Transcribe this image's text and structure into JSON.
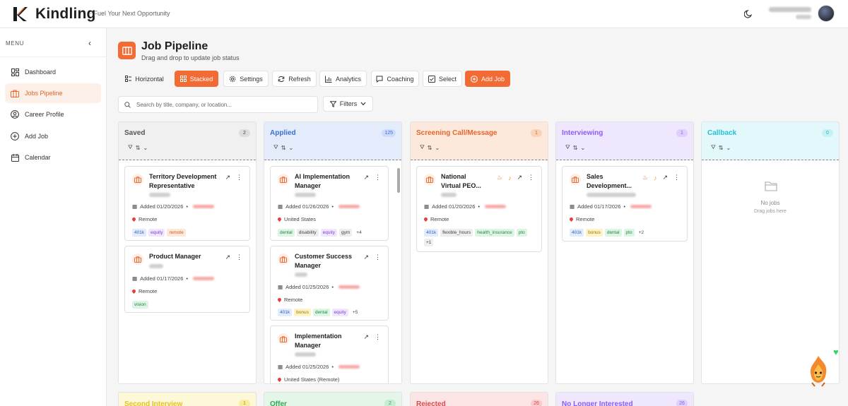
{
  "app": {
    "name": "Kindling",
    "tagline": "Fuel Your Next Opportunity"
  },
  "sidebar": {
    "menu_label": "MENU",
    "items": [
      {
        "label": "Dashboard"
      },
      {
        "label": "Jobs Pipeline"
      },
      {
        "label": "Career Profile"
      },
      {
        "label": "Add Job"
      },
      {
        "label": "Calendar"
      }
    ]
  },
  "page": {
    "title": "Job Pipeline",
    "subtitle": "Drag and drop to update job status"
  },
  "toolbar": {
    "horizontal": "Horizontal",
    "stacked": "Stacked",
    "settings": "Settings",
    "refresh": "Refresh",
    "analytics": "Analytics",
    "coaching": "Coaching",
    "select": "Select",
    "add_job": "Add Job"
  },
  "search": {
    "placeholder": "Search by title, company, or location..."
  },
  "filters_label": "Filters",
  "columns": [
    {
      "title": "Saved",
      "count": "2",
      "color": "#555555",
      "cards": [
        {
          "title": "Territory Development Representative",
          "added": "Added 01/20/2026",
          "location": "Remote",
          "tags": [
            "401k",
            "equity",
            "remote"
          ]
        },
        {
          "title": "Product Manager",
          "added": "Added 01/17/2026",
          "location": "Remote",
          "tags": [
            "vision"
          ]
        }
      ]
    },
    {
      "title": "Applied",
      "count": "125",
      "color": "#3b6fd1",
      "cards": [
        {
          "title": "AI Implementation Manager",
          "added": "Added 01/26/2026",
          "location": "United States",
          "tags": [
            "dental",
            "disability",
            "equity",
            "gym",
            "+4"
          ]
        },
        {
          "title": "Customer Success Manager",
          "added": "Added 01/25/2026",
          "location": "Remote",
          "tags": [
            "401k",
            "bonus",
            "dental",
            "equity",
            "+5"
          ]
        },
        {
          "title": "Implementation Manager",
          "added": "Added 01/25/2026",
          "location": "United States (Remote)",
          "tags": []
        }
      ]
    },
    {
      "title": "Screening Call/Message",
      "count": "1",
      "color": "#e8652a",
      "cards": [
        {
          "title": "National Virtual PEO...",
          "added": "Added 01/20/2026",
          "location": "Remote",
          "tags": [
            "401k",
            "flexible_hours",
            "health_insurance",
            "pto",
            "+1"
          ]
        }
      ]
    },
    {
      "title": "Interviewing",
      "count": "1",
      "color": "#8b5cf6",
      "cards": [
        {
          "title": "Sales Development...",
          "added": "Added 01/17/2026",
          "location": "Remote",
          "tags": [
            "401k",
            "bonus",
            "dental",
            "pto",
            "+2"
          ]
        }
      ]
    },
    {
      "title": "Callback",
      "count": "0",
      "color": "#22c1d6",
      "empty_title": "No jobs",
      "empty_sub": "Drag jobs here",
      "cards": []
    }
  ],
  "bottom_columns": [
    {
      "title": "Second Interview",
      "count": "1",
      "color": "#e6c21f"
    },
    {
      "title": "Offer",
      "count": "2",
      "color": "#2fa84f"
    },
    {
      "title": "Rejected",
      "count": "26",
      "color": "#d94a4a"
    },
    {
      "title": "No Longer Interested",
      "count": "26",
      "color": "#8b5cf6"
    }
  ]
}
